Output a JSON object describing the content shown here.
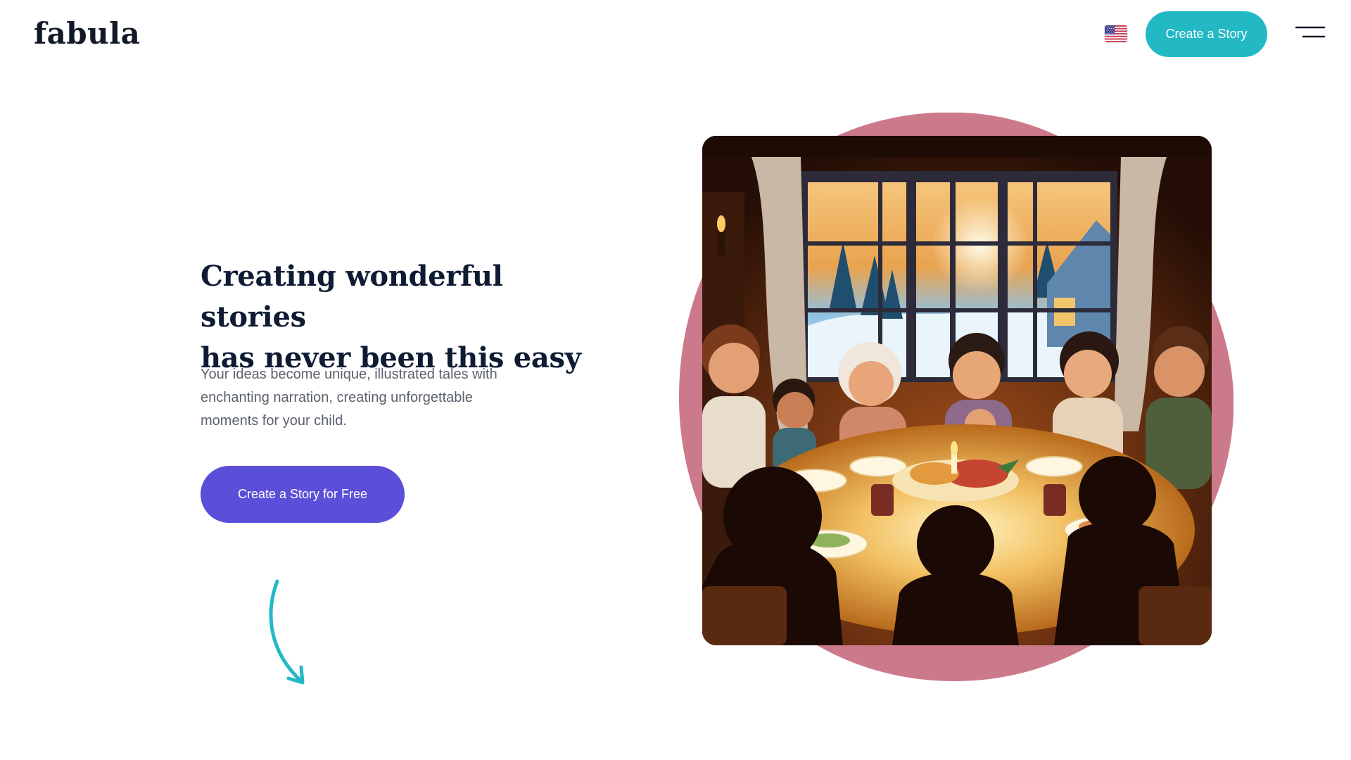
{
  "header": {
    "logo": "fabula",
    "language_flag": "us-flag-icon",
    "cta_label": "Create a Story",
    "menu_icon": "hamburger-menu-icon"
  },
  "hero": {
    "title_line1": "Creating wonderful stories",
    "title_line2": "has never been this easy",
    "subtitle": "Your ideas become unique, illustrated tales with enchanting narration, creating unforgettable moments for your child.",
    "cta_label": "Create a Story for Free",
    "scroll_arrow_icon": "curved-arrow-down-icon",
    "image_alt": "Illustrated family gathered around a candle-lit dinner table by a snowy window"
  },
  "colors": {
    "accent_teal": "#22b9c5",
    "primary_purple": "#5b4ed8",
    "blob_pink": "#cc7a8b",
    "heading": "#0e1b33",
    "body_text": "#5b616e"
  }
}
